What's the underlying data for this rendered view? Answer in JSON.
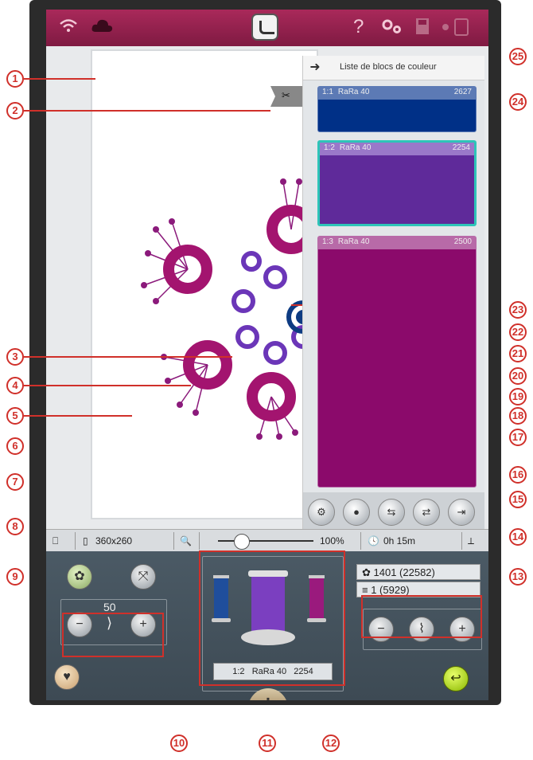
{
  "topbar": {
    "wifi_icon": "wifi-icon",
    "cloud_icon": "cloud-icon",
    "home_icon": "home-icon",
    "help_label": "?",
    "settings_icon": "gear-icon",
    "save_icon": "save-icon",
    "device_icon": "device-icon"
  },
  "color_panel": {
    "title": "Liste de blocs de couleur",
    "blocks": [
      {
        "index": "1:1",
        "thread": "RaRa 40",
        "number": "2627",
        "color": "#003087",
        "header_color": "#5c7ab5"
      },
      {
        "index": "1:2",
        "thread": "RaRa 40",
        "number": "2254",
        "color": "#5f2a9a",
        "header_color": "#9a78c9"
      },
      {
        "index": "1:3",
        "thread": "RaRa 40",
        "number": "2500",
        "color": "#8b0a6b",
        "header_color": "#b86aa8"
      }
    ]
  },
  "status_bar": {
    "hoop_size": "360x260",
    "zoom": "100%",
    "time": "0h 15m"
  },
  "controls": {
    "speed_value": "50",
    "minus_label": "−",
    "plus_label": "+"
  },
  "thread_info": {
    "label_index": "1:2",
    "label_thread": "RaRa 40",
    "label_number": "2254",
    "spool_colors": [
      "#1f4e9c",
      "#7b3fc0",
      "#9a1a7d"
    ]
  },
  "stitch_info": {
    "stitch_count": "1401 (22582)",
    "color_count": "1 (5929)"
  },
  "callouts": [
    "1",
    "2",
    "3",
    "4",
    "5",
    "6",
    "7",
    "8",
    "9",
    "10",
    "11",
    "12",
    "13",
    "14",
    "15",
    "16",
    "17",
    "18",
    "19",
    "20",
    "21",
    "22",
    "23",
    "24",
    "25"
  ]
}
